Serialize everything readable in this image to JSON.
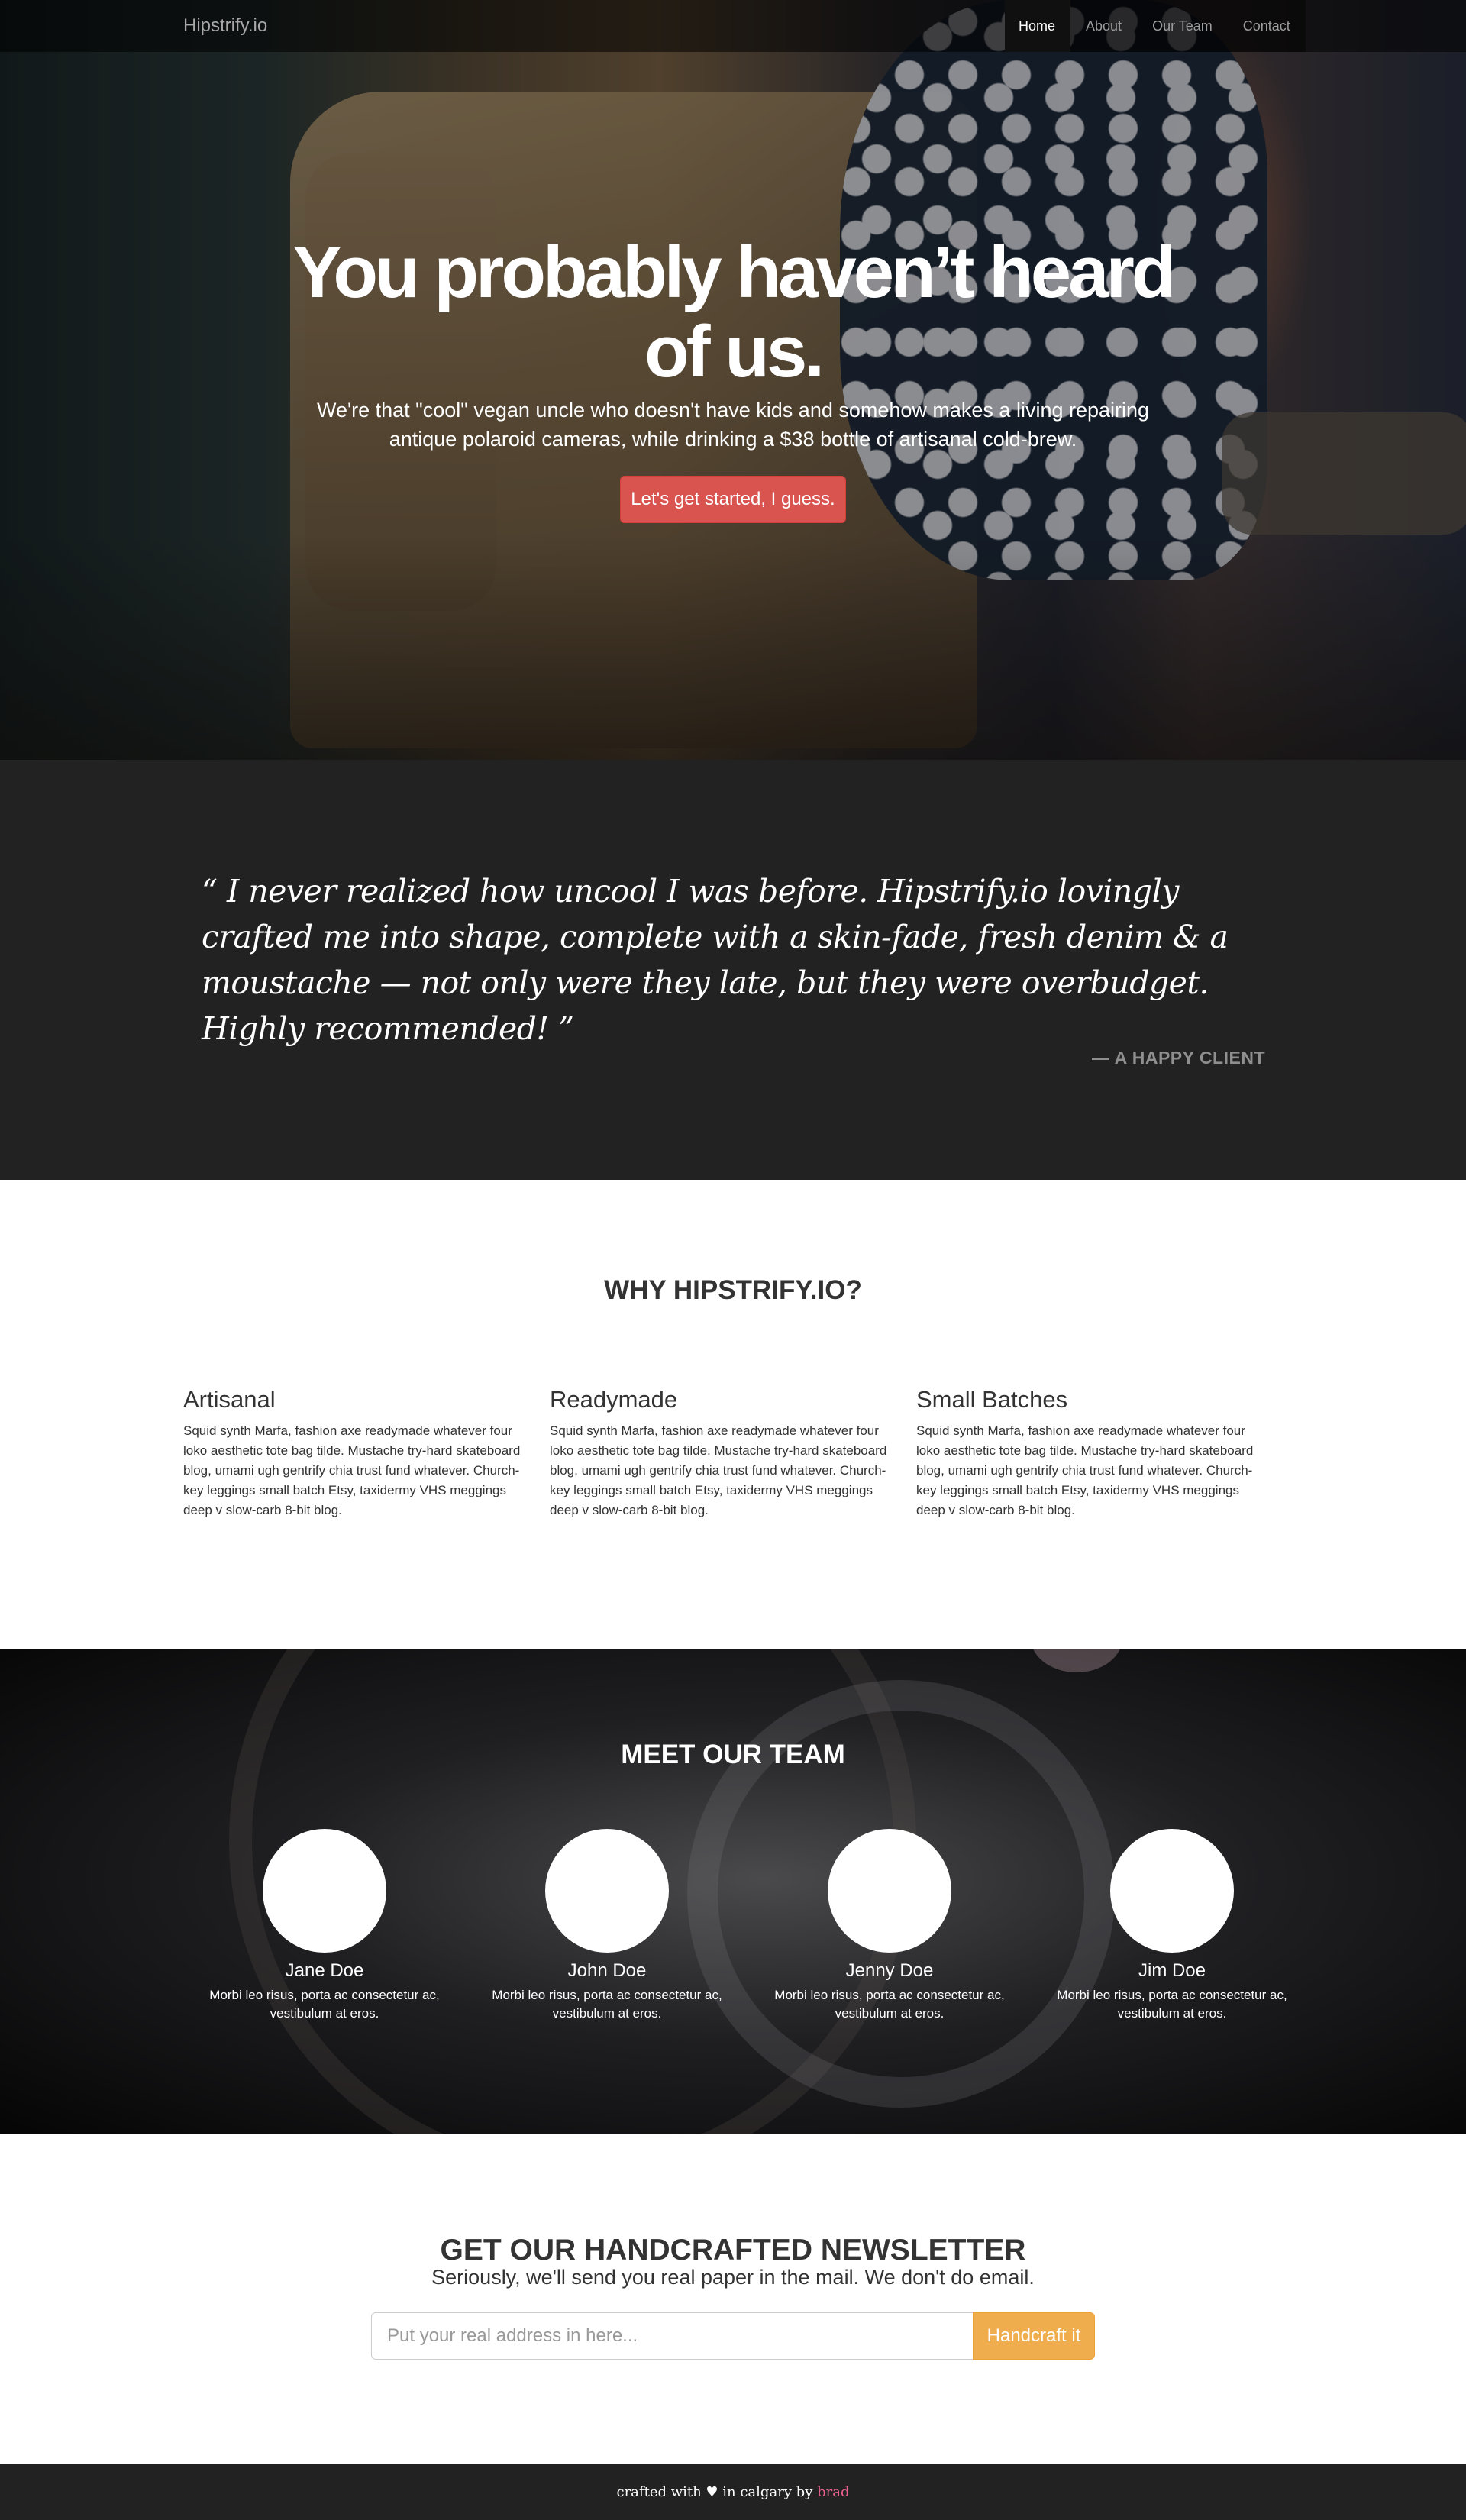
{
  "navbar": {
    "brand": "Hipstrify.io",
    "items": [
      {
        "label": "Home",
        "active": true
      },
      {
        "label": "About",
        "active": false
      },
      {
        "label": "Our Team",
        "active": false
      },
      {
        "label": "Contact",
        "active": false
      }
    ]
  },
  "hero": {
    "title": "You probably haven’t heard of us.",
    "subtitle": "We're that \"cool\" vegan uncle who doesn't have kids and somehow makes a living repairing antique polaroid cameras, while drinking a $38 bottle of artisanal cold-brew.",
    "cta_label": "Let's get started, I guess."
  },
  "testimonial": {
    "quote": "“ I never realized how uncool I was before. Hipstrify.io lovingly crafted me into shape, complete with a skin-fade, fresh denim & a moustache — not only were they late, but they were overbudget. Highly recommended! ”",
    "attribution": "— A HAPPY CLIENT"
  },
  "why": {
    "title": "WHY HIPSTRIFY.IO?",
    "features": [
      {
        "heading": "Artisanal",
        "body": "Squid synth Marfa, fashion axe readymade whatever four loko aesthetic tote bag tilde. Mustache try-hard skateboard blog, umami ugh gentrify chia trust fund whatever. Church-key leggings small batch Etsy, taxidermy VHS meggings deep v slow-carb 8-bit blog."
      },
      {
        "heading": "Readymade",
        "body": "Squid synth Marfa, fashion axe readymade whatever four loko aesthetic tote bag tilde. Mustache try-hard skateboard blog, umami ugh gentrify chia trust fund whatever. Church-key leggings small batch Etsy, taxidermy VHS meggings deep v slow-carb 8-bit blog."
      },
      {
        "heading": "Small Batches",
        "body": "Squid synth Marfa, fashion axe readymade whatever four loko aesthetic tote bag tilde. Mustache try-hard skateboard blog, umami ugh gentrify chia trust fund whatever. Church-key leggings small batch Etsy, taxidermy VHS meggings deep v slow-carb 8-bit blog."
      }
    ]
  },
  "team": {
    "title": "MEET OUR TEAM",
    "members": [
      {
        "name": "Jane Doe",
        "bio": "Morbi leo risus, porta ac consectetur ac, vestibulum at eros."
      },
      {
        "name": "John Doe",
        "bio": "Morbi leo risus, porta ac consectetur ac, vestibulum at eros."
      },
      {
        "name": "Jenny Doe",
        "bio": "Morbi leo risus, porta ac consectetur ac, vestibulum at eros."
      },
      {
        "name": "Jim Doe",
        "bio": "Morbi leo risus, porta ac consectetur ac, vestibulum at eros."
      }
    ]
  },
  "newsletter": {
    "title": "GET OUR HANDCRAFTED NEWSLETTER",
    "subtitle": "Seriously, we'll send you real paper in the mail. We don't do email.",
    "input_placeholder": "Put your real address in here...",
    "input_value": "",
    "button_label": "Handcraft it"
  },
  "footer": {
    "text_before": "crafted with ♥ in calgary by ",
    "author": "brad"
  },
  "colors": {
    "navbar_bg": "#101010",
    "cta_red": "#d9534f",
    "testimonial_bg": "#222222",
    "newsletter_button": "#f0ad4e",
    "footer_link": "#e8608f"
  }
}
